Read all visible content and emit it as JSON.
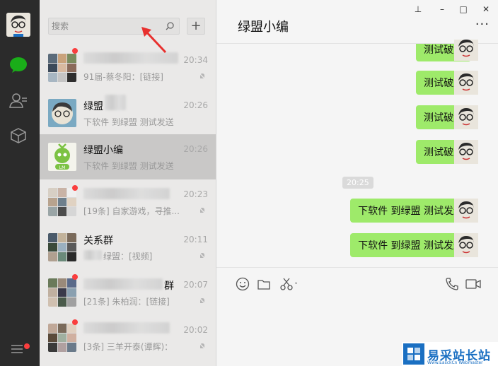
{
  "window": {
    "controls": {
      "pin": "⊥",
      "minimize": "–",
      "maximize": "□",
      "close": "✕"
    }
  },
  "rail": {
    "items": [
      {
        "icon": "chat-icon",
        "active": true
      },
      {
        "icon": "contacts-icon",
        "active": false
      },
      {
        "icon": "collections-icon",
        "active": false
      }
    ],
    "menu_icon": "menu-icon",
    "accent": "#1aad19"
  },
  "search": {
    "placeholder": "搜索",
    "add_label": "+"
  },
  "conversations": [
    {
      "name": "",
      "time": "20:34",
      "message": "91届-蔡冬阳：[链接]",
      "muted": true,
      "unread_dot": true
    },
    {
      "name": "绿盟",
      "time": "20:26",
      "message": "下软件 到绿盟 测试发送",
      "muted": false,
      "unread_dot": false
    },
    {
      "name": "绿盟小编",
      "time": "20:26",
      "message": "下软件 到绿盟 测试发送",
      "muted": false,
      "unread_dot": false,
      "active": true
    },
    {
      "name": "",
      "time": "20:23",
      "message": "[19条] 自家游戏，寻推...",
      "muted": true,
      "unread_dot": true
    },
    {
      "name": "关系群",
      "time": "20:11",
      "message": "绿盟：[视频]",
      "muted": true,
      "unread_dot": false
    },
    {
      "name": "群",
      "time": "20:07",
      "message": "[21条] 朱柏润：[链接]",
      "muted": true,
      "unread_dot": true
    },
    {
      "name": "",
      "time": "20:02",
      "message": "[3条] 三羊开泰(谭辉)：",
      "muted": true,
      "unread_dot": true
    }
  ],
  "chat": {
    "title": "绿盟小编",
    "more_label": "···",
    "messages": [
      {
        "text": "测试破解"
      },
      {
        "text": "测试破解"
      },
      {
        "text": "测试破解"
      },
      {
        "text": "测试破解"
      },
      {
        "text": "下软件 到绿盟 测试发送"
      },
      {
        "text": "下软件 到绿盟 测试发送"
      }
    ],
    "timestamp": "20:25",
    "bubble_color": "#9eea6a"
  },
  "toolbar": {
    "left": [
      "emoji-icon",
      "folder-icon",
      "scissors-icon"
    ],
    "right": [
      "phone-icon",
      "video-icon"
    ]
  },
  "watermark": {
    "text": "易采站长站",
    "sub": "Www.EasckCn Webmaster"
  }
}
